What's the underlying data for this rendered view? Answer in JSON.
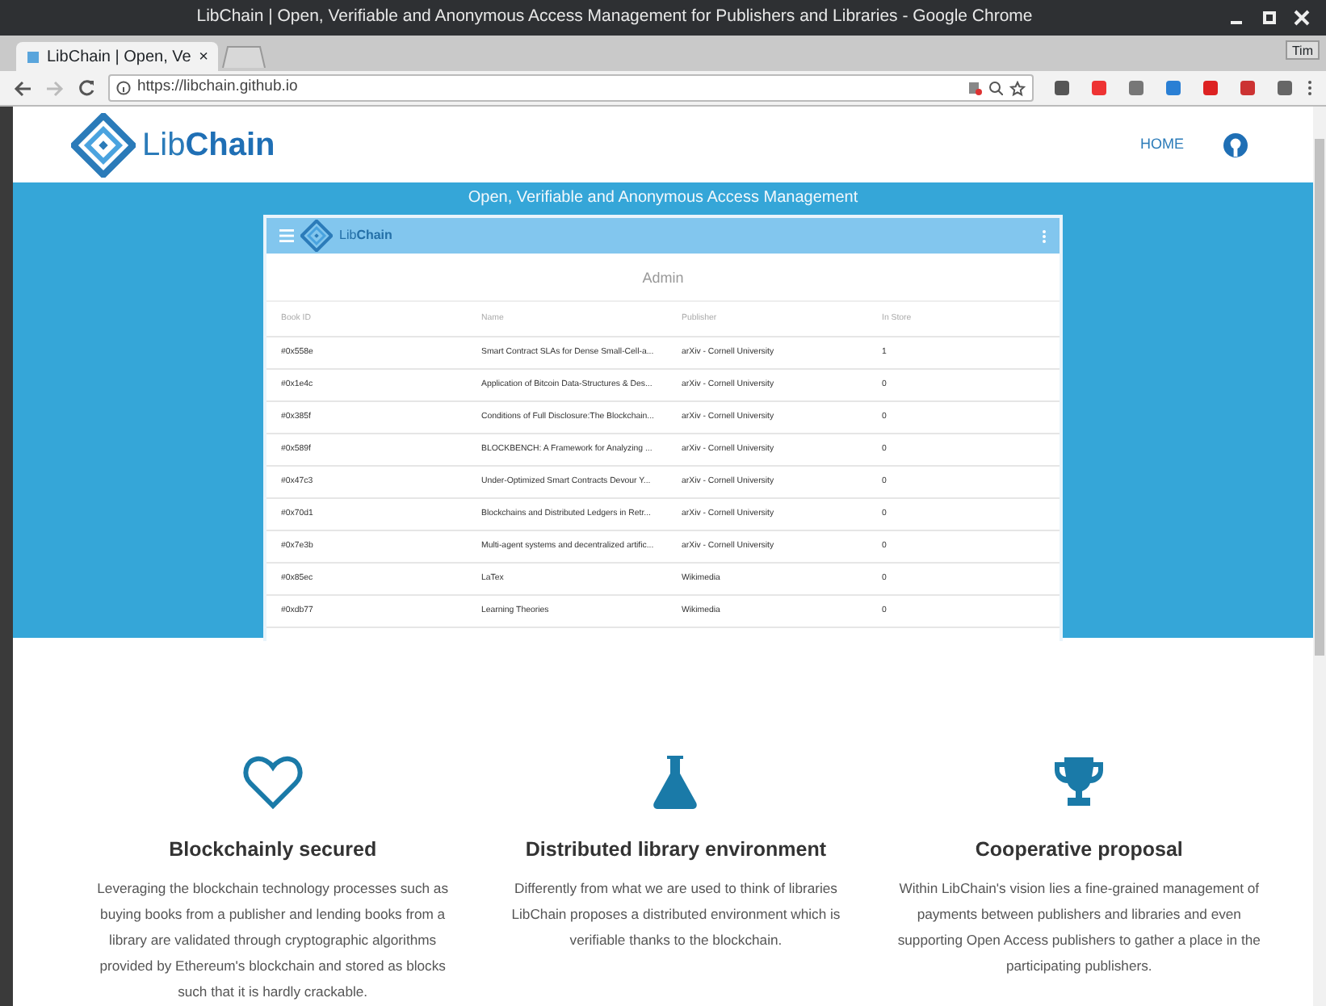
{
  "browser": {
    "window_title": "LibChain | Open, Verifiable and Anonymous Access Management for Publishers and Libraries - Google Chrome",
    "tab_title": "LibChain | Open, Ve",
    "tab_close": "×",
    "profile": "Tim",
    "url": "https://libchain.github.io"
  },
  "site": {
    "brand": "Lib**Chain**",
    "nav": [
      {
        "label": "HOME"
      }
    ],
    "tagline": "Open, Verifiable and Anonymous Access Management",
    "admin": {
      "brand": "Lib**Chain**",
      "title": "Admin",
      "columns": [
        "Book ID",
        "Name",
        "Publisher",
        "In Store"
      ],
      "rows": [
        [
          "#0x558e",
          "Smart Contract SLAs for Dense Small-Cell-a...",
          "arXiv - Cornell University",
          "1"
        ],
        [
          "#0x1e4c",
          "Application of Bitcoin Data-Structures & Des...",
          "arXiv - Cornell University",
          "0"
        ],
        [
          "#0x385f",
          "Conditions of Full Disclosure:The Blockchain...",
          "arXiv - Cornell University",
          "0"
        ],
        [
          "#0x589f",
          "BLOCKBENCH: A Framework for Analyzing ...",
          "arXiv - Cornell University",
          "0"
        ],
        [
          "#0x47c3",
          "Under-Optimized Smart Contracts Devour Y...",
          "arXiv - Cornell University",
          "0"
        ],
        [
          "#0x70d1",
          "Blockchains and Distributed Ledgers in Retr...",
          "arXiv - Cornell University",
          "0"
        ],
        [
          "#0x7e3b",
          "Multi-agent systems and decentralized artific...",
          "arXiv - Cornell University",
          "0"
        ],
        [
          "#0x85ec",
          "LaTex",
          "Wikimedia",
          "0"
        ],
        [
          "#0xdb77",
          "Learning Theories",
          "Wikimedia",
          "0"
        ]
      ]
    },
    "features": [
      {
        "title": "Blockchainly secured",
        "text": "Leveraging the blockchain technology processes such as buying books from a publisher and lending books from a library are validated through cryptographic algorithms provided by Ethereum's blockchain and stored as blocks such that it is hardly crackable."
      },
      {
        "title": "Distributed library environment",
        "text": "Differently from what we are used to think of libraries LibChain proposes a distributed environment which is verifiable thanks to the blockchain."
      },
      {
        "title": "Cooperative proposal",
        "text": "Within LibChain's vision lies a fine-grained management of payments between publishers and libraries and even supporting Open Access publishers to gather a place in the participating publishers."
      }
    ]
  }
}
